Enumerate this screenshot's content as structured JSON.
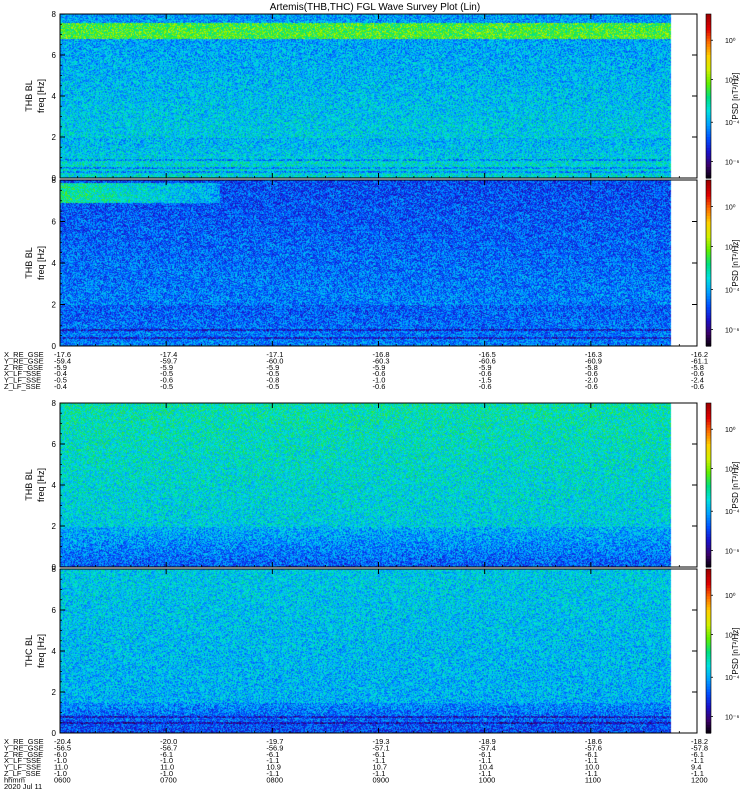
{
  "title": "Artemis(THB,THC) FGL Wave Survey Plot (Lin)",
  "colors": {
    "palette": [
      "#000000",
      "#3a0068",
      "#1a10c8",
      "#0050ff",
      "#00a0ff",
      "#00e0e0",
      "#00e080",
      "#60f000",
      "#d0f000",
      "#ffd000",
      "#ff7000",
      "#e00000",
      "#a00000"
    ],
    "gap": "#ffffff"
  },
  "colorbar": {
    "label": "PSD [nT²/Hz]",
    "ticks": [
      {
        "text": "10⁰",
        "frac": 0.16
      },
      {
        "text": "10⁻²",
        "frac": 0.4
      },
      {
        "text": "10⁻⁴",
        "frac": 0.66
      },
      {
        "text": "10⁻⁶",
        "frac": 0.9
      }
    ]
  },
  "ephem_top": {
    "rows": [
      {
        "label": "X_RE_GSE",
        "values": [
          "-17.6",
          "-17.4",
          "-17.1",
          "-16.8",
          "-16.5",
          "-16.3",
          "-16.2"
        ]
      },
      {
        "label": "Y_RE_GSE",
        "values": [
          "-59.4",
          "-59.7",
          "-60.0",
          "-60.3",
          "-60.6",
          "-60.9",
          "-61.1"
        ]
      },
      {
        "label": "Z_RE_GSE",
        "values": [
          "-5.9",
          "-5.9",
          "-5.9",
          "-5.9",
          "-5.9",
          "-5.8",
          "-5.8"
        ]
      },
      {
        "label": "X_LF_SSE",
        "values": [
          "-0.4",
          "-0.5",
          "-0.5",
          "-0.6",
          "-0.6",
          "-0.6",
          "-0.6"
        ]
      },
      {
        "label": "Y_LF_SSE",
        "values": [
          "-0.5",
          "-0.6",
          "-0.8",
          "-1.0",
          "-1.5",
          "-2.0",
          "-2.4"
        ]
      },
      {
        "label": "Z_LF_SSE",
        "values": [
          "-0.4",
          "-0.5",
          "-0.5",
          "-0.6",
          "-0.6",
          "-0.6",
          "-0.6"
        ]
      }
    ]
  },
  "ephem_bottom": {
    "rows": [
      {
        "label": "X_RE_GSE",
        "values": [
          "-20.4",
          "-20.0",
          "-19.7",
          "-19.3",
          "-18.9",
          "-18.6",
          "-18.2"
        ]
      },
      {
        "label": "Y_RE_GSE",
        "values": [
          "-56.5",
          "-56.7",
          "-56.9",
          "-57.1",
          "-57.4",
          "-57.6",
          "-57.8"
        ]
      },
      {
        "label": "Z_RE_GSE",
        "values": [
          "-6.0",
          "-6.1",
          "-6.1",
          "-6.1",
          "-6.1",
          "-6.1",
          "-6.1"
        ]
      },
      {
        "label": "X_LF_SSE",
        "values": [
          "-1.0",
          "-1.0",
          "-1.1",
          "-1.1",
          "-1.1",
          "-1.1",
          "-1.1"
        ]
      },
      {
        "label": "Y_LF_SSE",
        "values": [
          "11.0",
          "11.0",
          "10.9",
          "10.7",
          "10.4",
          "10.0",
          "9.4"
        ]
      },
      {
        "label": "Z_LF_SSE",
        "values": [
          "-1.0",
          "-1.0",
          "-1.1",
          "-1.1",
          "-1.1",
          "-1.1",
          "-1.1"
        ]
      },
      {
        "label": "hhmm",
        "values": [
          "0600",
          "0700",
          "0800",
          "0900",
          "1000",
          "1100",
          "1200"
        ]
      }
    ],
    "date": "2020 Jul 11"
  },
  "chart_data": [
    {
      "type": "heatmap",
      "ylabel": "THB BL",
      "yunit": "freq [Hz]",
      "ylim": [
        0,
        8
      ],
      "yticks": [
        0,
        2,
        4,
        6,
        8
      ],
      "x_time": [
        "0600",
        "0700",
        "0800",
        "0900",
        "1000",
        "1100",
        "1200"
      ],
      "data_end": "1145",
      "z_scale": "log",
      "z_range": [
        1e-07,
        10.0
      ],
      "features": {
        "high_band_hz": [
          6.8,
          7.6
        ],
        "low_freq_enhanced": true,
        "strong_tones_hz": [
          0.3,
          0.5,
          0.9
        ]
      }
    },
    {
      "type": "heatmap",
      "ylabel": "THB BL",
      "yunit": "freq [Hz]",
      "ylim": [
        0,
        8
      ],
      "yticks": [
        0,
        2,
        4,
        6,
        8
      ],
      "x_time": [
        "0600",
        "0700",
        "0800",
        "0900",
        "1000",
        "1100",
        "1200"
      ],
      "data_end": "1145",
      "z_scale": "log",
      "z_range": [
        1e-07,
        10.0
      ],
      "features": {
        "high_band_hz": [
          6.9,
          7.9
        ],
        "high_band_ends": "0730",
        "strong_tones_hz": [
          0.4,
          0.8
        ]
      }
    },
    {
      "type": "heatmap",
      "ylabel": "THB BL",
      "yunit": "freq [Hz]",
      "ylim": [
        0,
        8
      ],
      "yticks": [
        0,
        2,
        4,
        6,
        8
      ],
      "x_time": [
        "0600",
        "0700",
        "0800",
        "0900",
        "1000",
        "1100",
        "1200"
      ],
      "data_end": "1145",
      "z_scale": "log",
      "z_range": [
        1e-07,
        10.0
      ],
      "features": {
        "broadband_hz": [
          2.0,
          8.0
        ],
        "low_freq_dark_hz": [
          0.0,
          1.5
        ]
      }
    },
    {
      "type": "heatmap",
      "ylabel": "THC BL",
      "yunit": "freq [Hz]",
      "ylim": [
        0,
        8
      ],
      "yticks": [
        0,
        2,
        4,
        6,
        8
      ],
      "x_time": [
        "0600",
        "0700",
        "0800",
        "0900",
        "1000",
        "1100",
        "1200"
      ],
      "data_end": "1145",
      "z_scale": "log",
      "z_range": [
        1e-07,
        10.0
      ],
      "features": {
        "broadband_hz": [
          1.0,
          8.0
        ],
        "strong_tones_hz": [
          0.5,
          0.8
        ]
      }
    }
  ]
}
